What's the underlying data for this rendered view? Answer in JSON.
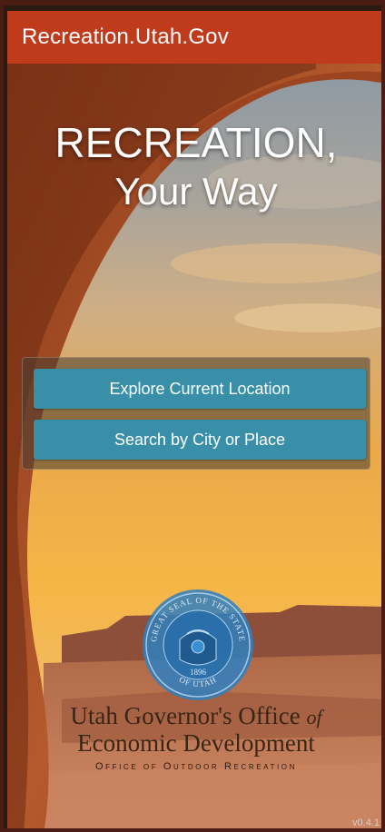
{
  "header": {
    "title": "Recreation.Utah.Gov"
  },
  "hero": {
    "line1": "RECREATION,",
    "line2": "Your Way"
  },
  "actions": {
    "explore_label": "Explore Current Location",
    "search_label": "Search by City or Place"
  },
  "seal": {
    "top_text": "GREAT SEAL OF THE STATE",
    "bottom_text": "OF UTAH",
    "year": "1896"
  },
  "org": {
    "line1_main": "Utah Governor's Office",
    "line1_of": "of",
    "line2": "Economic Development",
    "line3": "Office of Outdoor Recreation"
  },
  "version": "v0.4.1",
  "colors": {
    "header": "#c03a1c",
    "button": "#3a8fa8",
    "seal": "#2f7fc0"
  }
}
